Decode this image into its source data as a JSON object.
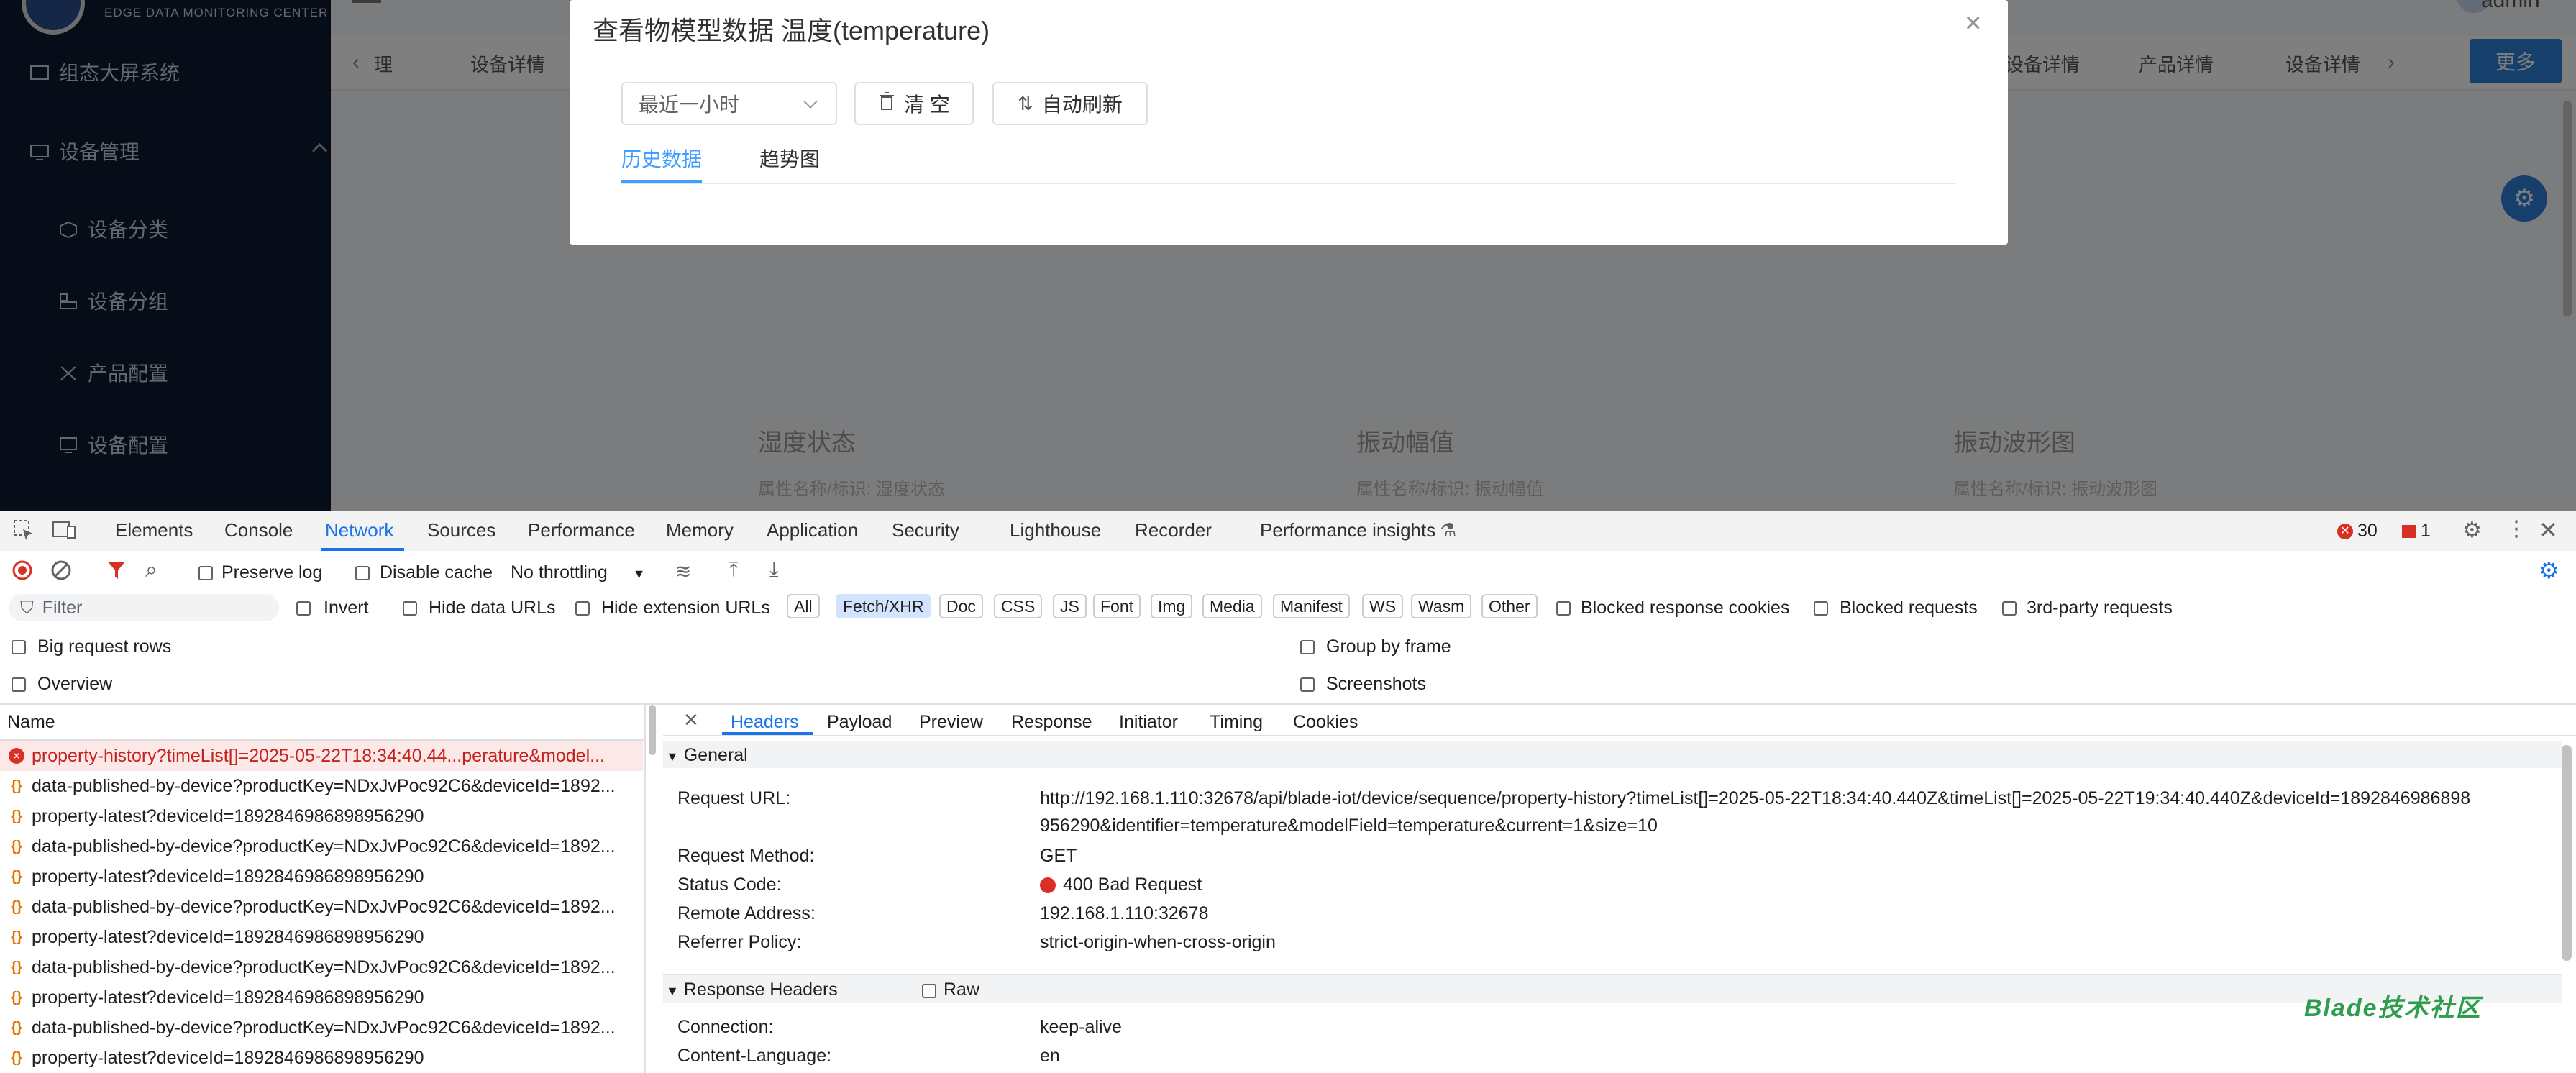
{
  "app": {
    "brand_subtitle": "EDGE DATA MONITORING CENTER",
    "user_name": "admin",
    "more_label": "更多",
    "sidebar": {
      "items": [
        {
          "label": "组态大屏系统",
          "icon": "monitor-icon"
        },
        {
          "label": "设备管理",
          "icon": "device-icon",
          "expanded": true
        },
        {
          "label": "设备分类",
          "icon": "cube-icon"
        },
        {
          "label": "设备分组",
          "icon": "group-icon"
        },
        {
          "label": "产品配置",
          "icon": "tools-icon"
        },
        {
          "label": "设备配置",
          "icon": "screen-icon"
        }
      ]
    },
    "tabs": [
      "理",
      "设备详情",
      "设备详情",
      "产品详情",
      "设备详情"
    ],
    "cards": {
      "titles": [
        "湿度状态",
        "振动幅值",
        "振动波形图"
      ],
      "subtitles": [
        "属性名称/标识: 湿度状态",
        "属性名称/标识: 振动幅值",
        "属性名称/标识: 振动波形图"
      ]
    }
  },
  "dialog": {
    "title": "查看物模型数据 温度(temperature)",
    "time_range": "最近一小时",
    "clear_label": "清 空",
    "auto_refresh_label": "自动刷新",
    "tabs": [
      {
        "label": "历史数据",
        "active": true
      },
      {
        "label": "趋势图",
        "active": false
      }
    ]
  },
  "devtools": {
    "tabs": [
      "Elements",
      "Console",
      "Network",
      "Sources",
      "Performance",
      "Memory",
      "Application",
      "Security",
      "Lighthouse",
      "Recorder",
      "Performance insights"
    ],
    "active_tab": "Network",
    "error_count": "30",
    "issue_count": "1",
    "toolbar": {
      "preserve_log": "Preserve log",
      "disable_cache": "Disable cache",
      "throttling": "No throttling"
    },
    "filter": {
      "placeholder": "Filter",
      "invert": "Invert",
      "hide_data_urls": "Hide data URLs",
      "hide_extension_urls": "Hide extension URLs",
      "types": [
        "All",
        "Fetch/XHR",
        "Doc",
        "CSS",
        "JS",
        "Font",
        "Img",
        "Media",
        "Manifest",
        "WS",
        "Wasm",
        "Other"
      ],
      "active_type": "Fetch/XHR",
      "blocked_response_cookies": "Blocked response cookies",
      "blocked_requests": "Blocked requests",
      "third_party": "3rd-party requests"
    },
    "options": {
      "big_request_rows": "Big request rows",
      "group_by_frame": "Group by frame",
      "overview": "Overview",
      "screenshots": "Screenshots"
    },
    "list_header": "Name",
    "requests": [
      {
        "name": "property-history?timeList[]=2025-05-22T18:34:40.44...perature&model...",
        "status": "error"
      },
      {
        "name": "data-published-by-device?productKey=NDxJvPoc92C6&deviceId=1892...",
        "status": "ok"
      },
      {
        "name": "property-latest?deviceId=1892846986898956290",
        "status": "ok"
      },
      {
        "name": "data-published-by-device?productKey=NDxJvPoc92C6&deviceId=1892...",
        "status": "ok"
      },
      {
        "name": "property-latest?deviceId=1892846986898956290",
        "status": "ok"
      },
      {
        "name": "data-published-by-device?productKey=NDxJvPoc92C6&deviceId=1892...",
        "status": "ok"
      },
      {
        "name": "property-latest?deviceId=1892846986898956290",
        "status": "ok"
      },
      {
        "name": "data-published-by-device?productKey=NDxJvPoc92C6&deviceId=1892...",
        "status": "ok"
      },
      {
        "name": "property-latest?deviceId=1892846986898956290",
        "status": "ok"
      },
      {
        "name": "data-published-by-device?productKey=NDxJvPoc92C6&deviceId=1892...",
        "status": "ok"
      },
      {
        "name": "property-latest?deviceId=1892846986898956290",
        "status": "ok"
      }
    ],
    "detail_tabs": [
      "Headers",
      "Payload",
      "Preview",
      "Response",
      "Initiator",
      "Timing",
      "Cookies"
    ],
    "active_detail_tab": "Headers",
    "general": {
      "section": "General",
      "request_url_key": "Request URL:",
      "request_url_line1": "http://192.168.1.110:32678/api/blade-iot/device/sequence/property-history?timeList[]=2025-05-22T18:34:40.440Z&timeList[]=2025-05-22T19:34:40.440Z&deviceId=1892846986898",
      "request_url_line2": "956290&identifier=temperature&modelField=temperature&current=1&size=10",
      "request_method_key": "Request Method:",
      "request_method": "GET",
      "status_code_key": "Status Code:",
      "status_code": "400 Bad Request",
      "remote_address_key": "Remote Address:",
      "remote_address": "192.168.1.110:32678",
      "referrer_policy_key": "Referrer Policy:",
      "referrer_policy": "strict-origin-when-cross-origin"
    },
    "response_headers": {
      "section": "Response Headers",
      "raw_label": "Raw",
      "connection_key": "Connection:",
      "connection": "keep-alive",
      "content_language_key": "Content-Language:",
      "content_language": "en"
    },
    "watermark": "Blade技术社区"
  },
  "colors": {
    "accent": "#1a73e8",
    "error": "#d93025",
    "sidebar_bg": "#0c1b33",
    "primary_btn": "#2f7fd9"
  }
}
